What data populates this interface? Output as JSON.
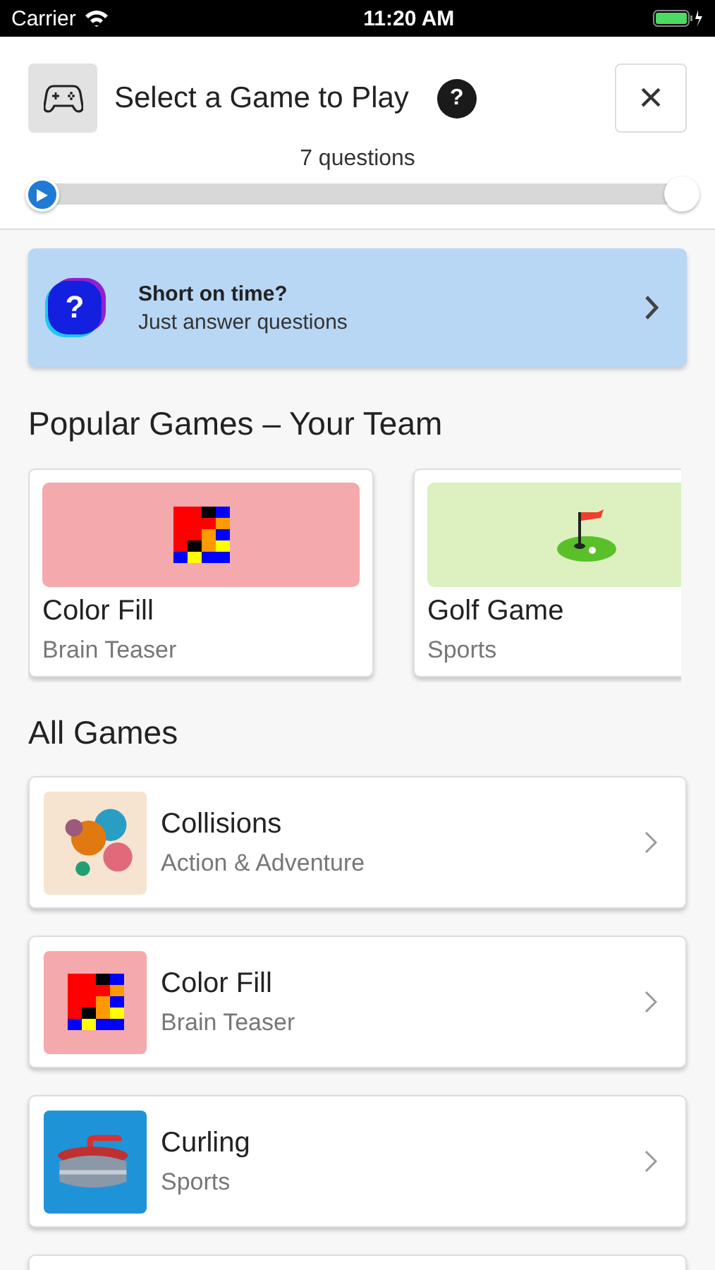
{
  "status_bar": {
    "carrier": "Carrier",
    "time": "11:20 AM"
  },
  "header": {
    "title": "Select a Game to Play",
    "help": "?",
    "close": "×",
    "question_count": "7 questions",
    "slider": {
      "level": 0
    }
  },
  "banner": {
    "title": "Short on time?",
    "subtitle": "Just answer questions",
    "badge": "?"
  },
  "popular": {
    "heading": "Popular Games – Your Team",
    "games": [
      {
        "name": "Color Fill",
        "category": "Brain Teaser",
        "kind": "colorfill",
        "color": "#f4a9ac"
      },
      {
        "name": "Golf Game",
        "category": "Sports",
        "kind": "golf",
        "color": "#dcf0c0"
      }
    ]
  },
  "all_games": {
    "heading": "All Games",
    "games": [
      {
        "name": "Collisions",
        "category": "Action & Adventure",
        "kind": "collisions",
        "color": "#f7e4d0"
      },
      {
        "name": "Color Fill",
        "category": "Brain Teaser",
        "kind": "colorfill",
        "color": "#f4a9ac"
      },
      {
        "name": "Curling",
        "category": "Sports",
        "kind": "curling",
        "color": "#1f93d8"
      }
    ]
  }
}
